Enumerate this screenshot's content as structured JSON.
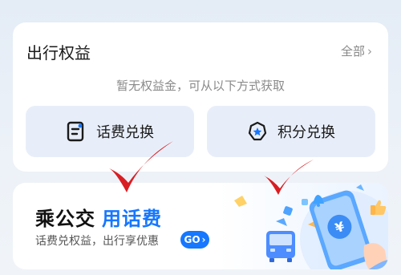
{
  "benefits": {
    "title": "出行权益",
    "all_label": "全部",
    "empty_hint": "暂无权益金，可从以下方式获取",
    "options": [
      {
        "label": "话费兑换",
        "icon": "phone-bill-icon"
      },
      {
        "label": "积分兑换",
        "icon": "points-badge-icon"
      }
    ]
  },
  "promo": {
    "title_dark": "乘公交",
    "title_blue": "用话费",
    "subtitle": "话费兑权益，出行享优惠",
    "go_label": "GO"
  },
  "colors": {
    "accent": "#1677ff",
    "check": "#d81e23"
  }
}
